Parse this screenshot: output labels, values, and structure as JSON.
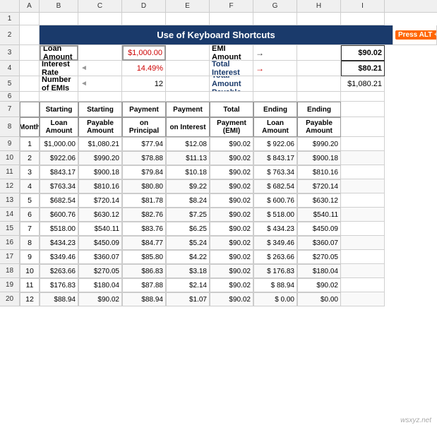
{
  "title": "Use of Keyboard Shortcuts",
  "altBadge": "Press ALT + M + D",
  "infoSection": {
    "loanAmount": {
      "label": "Loan Amount",
      "value": "$1,000.00"
    },
    "interestRate": {
      "label": "Interest Rate",
      "value": "14.49%"
    },
    "numEMIs": {
      "label": "Number of EMIs",
      "value": "12"
    },
    "emiAmount": {
      "label": "EMI Amount",
      "value": "$90.02"
    },
    "totalInterest": {
      "label": "Total Interest",
      "value": "$80.21"
    },
    "totalAmountPayable": {
      "label": "Total Amount Payable",
      "value": "$1,080.21"
    }
  },
  "tableHeaders": {
    "month": "Month",
    "startingLoanAmount": "Starting Loan Amount",
    "startingPayableAmount": "Starting Payable Amount",
    "paymentOnPrincipal": "Payment on Principal",
    "paymentOnInterest": "Payment on Interest",
    "totalPaymentEMI": "Total Payment (EMI)",
    "endingLoanAmount": "Ending Loan Amount",
    "endingPayableAmount": "Ending Payable Amount"
  },
  "tableRows": [
    {
      "month": 1,
      "sla": "$1,000.00",
      "spa": "$1,080.21",
      "pp": "$77.94",
      "pi": "$12.08",
      "tpe": "$90.02",
      "ela": "$ 922.06",
      "epa": "$990.20"
    },
    {
      "month": 2,
      "sla": "$922.06",
      "spa": "$990.20",
      "pp": "$78.88",
      "pi": "$11.13",
      "tpe": "$90.02",
      "ela": "$ 843.17",
      "epa": "$900.18"
    },
    {
      "month": 3,
      "sla": "$843.17",
      "spa": "$900.18",
      "pp": "$79.84",
      "pi": "$10.18",
      "tpe": "$90.02",
      "ela": "$ 763.34",
      "epa": "$810.16"
    },
    {
      "month": 4,
      "sla": "$763.34",
      "spa": "$810.16",
      "pp": "$80.80",
      "pi": "$9.22",
      "tpe": "$90.02",
      "ela": "$ 682.54",
      "epa": "$720.14"
    },
    {
      "month": 5,
      "sla": "$682.54",
      "spa": "$720.14",
      "pp": "$81.78",
      "pi": "$8.24",
      "tpe": "$90.02",
      "ela": "$ 600.76",
      "epa": "$630.12"
    },
    {
      "month": 6,
      "sla": "$600.76",
      "spa": "$630.12",
      "pp": "$82.76",
      "pi": "$7.25",
      "tpe": "$90.02",
      "ela": "$ 518.00",
      "epa": "$540.11"
    },
    {
      "month": 7,
      "sla": "$518.00",
      "spa": "$540.11",
      "pp": "$83.76",
      "pi": "$6.25",
      "tpe": "$90.02",
      "ela": "$ 434.23",
      "epa": "$450.09"
    },
    {
      "month": 8,
      "sla": "$434.23",
      "spa": "$450.09",
      "pp": "$84.77",
      "pi": "$5.24",
      "tpe": "$90.02",
      "ela": "$ 349.46",
      "epa": "$360.07"
    },
    {
      "month": 9,
      "sla": "$349.46",
      "spa": "$360.07",
      "pp": "$85.80",
      "pi": "$4.22",
      "tpe": "$90.02",
      "ela": "$ 263.66",
      "epa": "$270.05"
    },
    {
      "month": 10,
      "sla": "$263.66",
      "spa": "$270.05",
      "pp": "$86.83",
      "pi": "$3.18",
      "tpe": "$90.02",
      "ela": "$ 176.83",
      "epa": "$180.04"
    },
    {
      "month": 11,
      "sla": "$176.83",
      "spa": "$180.04",
      "pp": "$87.88",
      "pi": "$2.14",
      "tpe": "$90.02",
      "ela": "$  88.94",
      "epa": "$90.02"
    },
    {
      "month": 12,
      "sla": "$88.94",
      "spa": "$90.02",
      "pp": "$88.94",
      "pi": "$1.07",
      "tpe": "$90.02",
      "ela": "$   0.00",
      "epa": "$0.00"
    }
  ],
  "colHeaders": [
    "",
    "A",
    "B",
    "C",
    "D",
    "E",
    "F",
    "G",
    "H",
    "I"
  ],
  "rowNumbers": [
    1,
    2,
    3,
    4,
    5,
    6,
    7,
    8,
    9,
    10,
    11,
    12,
    13,
    14,
    15,
    16,
    17,
    18,
    19,
    20
  ]
}
